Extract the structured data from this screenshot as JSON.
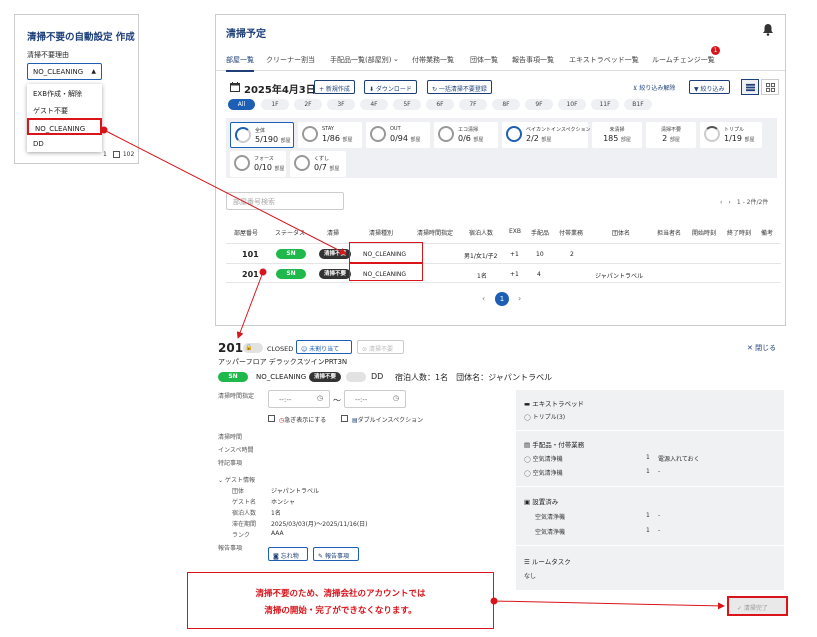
{
  "left_panel": {
    "title": "清掃不要の自動設定 作成",
    "reason_label": "清掃不要理由",
    "selected_value": "NO_CLEANING",
    "options": [
      "EXB作成・解除",
      "ゲスト不要",
      "NO_CLEANING",
      "DD"
    ],
    "behind_text": "1",
    "behind_number": "102"
  },
  "main": {
    "title": "清掃予定",
    "tabs": [
      "部屋一覧",
      "クリーナー割当",
      "手配品一覧(部屋別)",
      "付帯業務一覧",
      "団体一覧",
      "報告事項一覧",
      "エキストラベッド一覧",
      "ルームチェンジ一覧"
    ],
    "tab_badge": "1",
    "date": "2025年4月3日",
    "buttons": {
      "new": "+ 新規作成",
      "download": "⬇ ダウンロード",
      "bulk": "↻ 一括清掃不要登録",
      "clear_filter": "絞り込み解除",
      "filter": "絞り込み"
    },
    "floors": [
      "All",
      "1F",
      "2F",
      "3F",
      "4F",
      "5F",
      "6F",
      "7F",
      "8F",
      "9F",
      "10F",
      "11F",
      "B1F"
    ],
    "summary": [
      {
        "label": "全体",
        "value": "5/190",
        "unit": "部屋"
      },
      {
        "label": "STAY",
        "value": "1/86",
        "unit": "部屋"
      },
      {
        "label": "OUT",
        "value": "0/94",
        "unit": "部屋"
      },
      {
        "label": "エコ清掃",
        "value": "0/6",
        "unit": "部屋"
      },
      {
        "label": "ベイカントインスペクション",
        "value": "2/2",
        "unit": "部屋"
      },
      {
        "label": "未清掃",
        "value": "185",
        "unit": "部屋"
      },
      {
        "label": "清掃不要",
        "value": "2",
        "unit": "部屋"
      },
      {
        "label": "トリプル",
        "value": "1/19",
        "unit": "部屋"
      },
      {
        "label": "フォース",
        "value": "0/10",
        "unit": "部屋"
      },
      {
        "label": "くずし",
        "value": "0/7",
        "unit": "部屋"
      }
    ],
    "search_placeholder": "部屋番号検索",
    "pager": "1 - 2件/2件",
    "columns": [
      "部屋番号",
      "ステータス",
      "清掃",
      "清掃種別",
      "清掃時間指定",
      "宿泊人数",
      "EXB",
      "手配品",
      "付帯業務",
      "団体名",
      "担当者名",
      "開始時刻",
      "終了時刻",
      "備考"
    ],
    "rows": [
      {
        "room": "101",
        "status": "SN",
        "clean": "清掃不要",
        "type": "NO_CLEANING",
        "guests": "男1/女1/子2",
        "exb": "+1",
        "items": "10",
        "tasks": "2",
        "group": ""
      },
      {
        "room": "201",
        "status": "SN",
        "clean": "清掃不要",
        "type": "NO_CLEANING",
        "guests": "1名",
        "exb": "+1",
        "items": "4",
        "tasks": "",
        "group": "ジャパントラベル"
      }
    ],
    "page": "1"
  },
  "detail": {
    "room": "201",
    "closed": "CLOSED",
    "unassigned": "未割り当て",
    "not_needed": "清掃不要",
    "close": "閉じる",
    "room_type": "アッパーフロア デラックスツインPRT3N",
    "status": "SN",
    "cleaning_type": "NO_CLEANING",
    "clean_badge": "清掃不要",
    "dd": "DD",
    "guest_summary": "宿泊人数：1名　団体名：ジャパントラベル",
    "time_label": "清掃時間指定",
    "time_placeholder": "--:--",
    "time_sep": "〜",
    "urgent": "急ぎ表示にする",
    "double_inspection": "ダブルインスペクション",
    "labels": [
      "清掃時間",
      "インスペ時間",
      "特記事項"
    ],
    "guest_info_label": "ゲスト情報",
    "guest_fields": [
      {
        "k": "団体",
        "v": "ジャパントラベル"
      },
      {
        "k": "ゲスト名",
        "v": "ホンシャ"
      },
      {
        "k": "宿泊人数",
        "v": "1名"
      },
      {
        "k": "滞在期間",
        "v": "2025/03/03(月)～2025/11/16(日)"
      },
      {
        "k": "ランク",
        "v": "AAA"
      }
    ],
    "report_label": "報告事項",
    "lost_item": "忘れ物",
    "report_button": "報告事項"
  },
  "info": {
    "extra_bed_title": "エキストラベッド",
    "extra_bed_item": "トリプル(3)",
    "supplies_title": "手配品・付帯業務",
    "supplies": [
      {
        "name": "空気清浄機",
        "qty": "1",
        "note": "電源入れておく"
      },
      {
        "name": "空気清浄機",
        "qty": "1",
        "note": "-"
      }
    ],
    "installed_title": "設置済み",
    "installed": [
      {
        "name": "空気清浄機",
        "qty": "1",
        "note": "-"
      },
      {
        "name": "空気清浄機",
        "qty": "1",
        "note": "-"
      }
    ],
    "room_task_title": "ルームタスク",
    "room_task_value": "なし",
    "complete_button": "✓ 清掃完了"
  },
  "callout": {
    "line1": "清掃不要のため、清掃会社のアカウントでは",
    "line2": "清掃の開始・完了ができなくなります。"
  },
  "colors": {
    "accent": "#1d5fb4",
    "title": "#1d3f7a",
    "alert": "#d9141b",
    "status_green": "#1fb84a"
  }
}
